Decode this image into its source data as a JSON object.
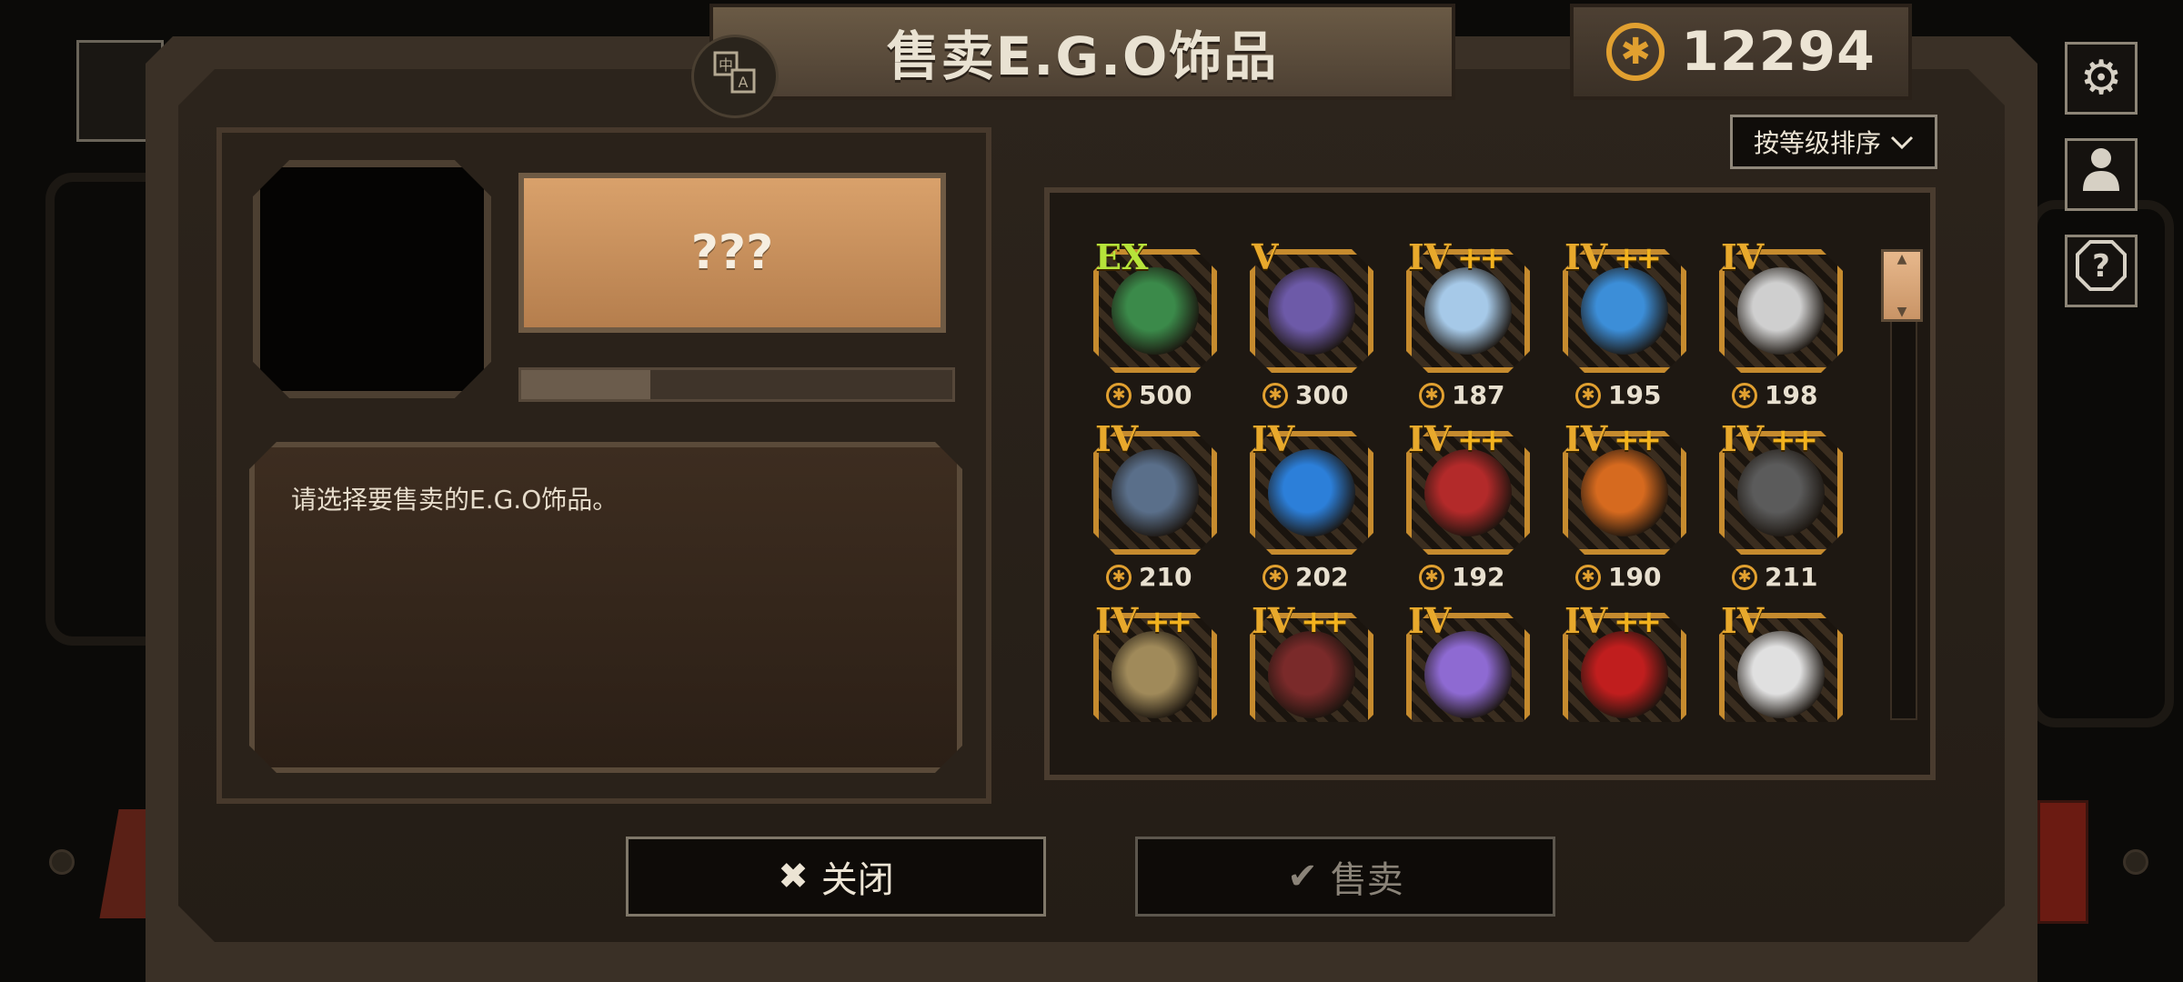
{
  "header": {
    "title": "售卖E.G.O饰品",
    "translate_icon": "translate-icon",
    "currency_icon": "coin-icon",
    "currency_value": "12294"
  },
  "side_buttons": {
    "settings_icon": "gear-icon",
    "profile_icon": "person-icon",
    "help_icon": "help-icon"
  },
  "sort": {
    "label": "按等级排序"
  },
  "detail": {
    "name": "???",
    "progress": 0.3,
    "description": "请选择要售卖的E.G.O饰品。"
  },
  "inventory": {
    "items": [
      {
        "grade": "EX",
        "plus": "",
        "price": "500",
        "color": "#3b8a4a",
        "icon": "money-pile-icon"
      },
      {
        "grade": "V",
        "plus": "",
        "price": "300",
        "color": "#6d5aa8",
        "icon": "paper-scrap-icon"
      },
      {
        "grade": "IV",
        "plus": "++",
        "price": "187",
        "color": "#a6c9e8",
        "icon": "liquid-flask-icon"
      },
      {
        "grade": "IV",
        "plus": "++",
        "price": "195",
        "color": "#3c8ed8",
        "icon": "water-orb-icon"
      },
      {
        "grade": "IV",
        "plus": "",
        "price": "198",
        "color": "#cfcfcf",
        "icon": "document-icon"
      },
      {
        "grade": "IV",
        "plus": "",
        "price": "210",
        "color": "#5a6f8a",
        "icon": "mechanical-gate-icon"
      },
      {
        "grade": "IV",
        "plus": "",
        "price": "202",
        "color": "#2c7fd9",
        "icon": "rain-cloud-icon"
      },
      {
        "grade": "IV",
        "plus": "++",
        "price": "192",
        "color": "#b32a2a",
        "icon": "red-flower-icon"
      },
      {
        "grade": "IV",
        "plus": "++",
        "price": "190",
        "color": "#d66a1f",
        "icon": "ember-stone-icon"
      },
      {
        "grade": "IV",
        "plus": "++",
        "price": "211",
        "color": "#5b5b5b",
        "icon": "broken-crystal-icon"
      },
      {
        "grade": "IV",
        "plus": "++",
        "price": "",
        "color": "#a08a5a",
        "icon": "machine-debris-icon"
      },
      {
        "grade": "IV",
        "plus": "++",
        "price": "",
        "color": "#7a2a2a",
        "icon": "rose-vine-icon"
      },
      {
        "grade": "IV",
        "plus": "",
        "price": "",
        "color": "#8e6ad2",
        "icon": "potion-bottle-icon"
      },
      {
        "grade": "IV",
        "plus": "++",
        "price": "",
        "color": "#c01e1e",
        "icon": "blood-flower-icon"
      },
      {
        "grade": "IV",
        "plus": "",
        "price": "",
        "color": "#e0e0e0",
        "icon": "white-shard-icon"
      }
    ]
  },
  "buttons": {
    "close_label": "关闭",
    "close_icon": "close-icon",
    "sell_label": "售卖",
    "sell_icon": "check-icon"
  }
}
